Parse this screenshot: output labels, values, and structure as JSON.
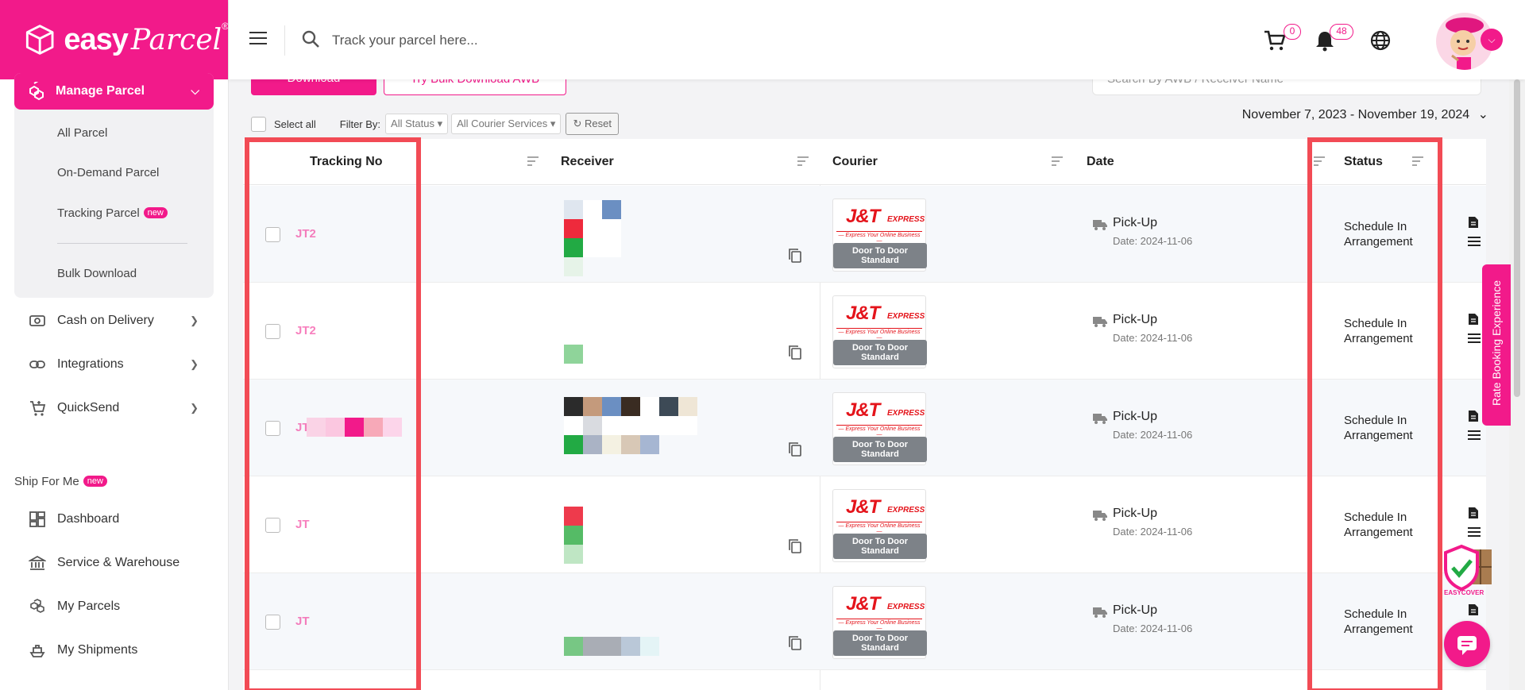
{
  "brand": {
    "name_easy": "easy",
    "name_parcel": "Parcel",
    "reg": "®"
  },
  "header": {
    "search_placeholder": "Track your parcel here...",
    "cart_count": "0",
    "notification_count": "48"
  },
  "sidebar": {
    "active": "Manage Parcel",
    "sub_items": [
      "All Parcel",
      "On-Demand Parcel",
      "Tracking Parcel",
      "Bulk Download"
    ],
    "new_badge": "new",
    "menu": [
      "Cash on Delivery",
      "Integrations",
      "QuickSend"
    ],
    "section": "Ship For Me",
    "ship_items": [
      "Dashboard",
      "Service & Warehouse",
      "My Parcels",
      "My Shipments"
    ]
  },
  "toolbar": {
    "download_label": "Download",
    "bulk_label": "Try Bulk Download AWB",
    "search_placeholder": "Search By AWB / Receiver Name",
    "select_all": "Select all",
    "filter_by": "Filter By:",
    "status_filter": "All Status",
    "courier_filter": "All Courier Services",
    "reset": "Reset",
    "date_range": "November 7, 2023 - November 19, 2024"
  },
  "table": {
    "columns": [
      "Tracking No",
      "Receiver",
      "Courier",
      "Date",
      "Status"
    ],
    "rows": [
      {
        "tracking": "JT2",
        "courier_brand": "J&T",
        "courier_sub": "EXPRESS",
        "tagline": "— Express Your Online Business —",
        "service": "Door To Door Standard",
        "method": "Pick-Up",
        "date": "Date: 2024-11-06",
        "status": "Schedule In Arrangement"
      },
      {
        "tracking": "JT2",
        "courier_brand": "J&T",
        "courier_sub": "EXPRESS",
        "tagline": "— Express Your Online Business —",
        "service": "Door To Door Standard",
        "method": "Pick-Up",
        "date": "Date: 2024-11-06",
        "status": "Schedule In Arrangement"
      },
      {
        "tracking": "JT",
        "courier_brand": "J&T",
        "courier_sub": "EXPRESS",
        "tagline": "— Express Your Online Business —",
        "service": "Door To Door Standard",
        "method": "Pick-Up",
        "date": "Date: 2024-11-06",
        "status": "Schedule In Arrangement"
      },
      {
        "tracking": "JT",
        "courier_brand": "J&T",
        "courier_sub": "EXPRESS",
        "tagline": "— Express Your Online Business —",
        "service": "Door To Door Standard",
        "method": "Pick-Up",
        "date": "Date: 2024-11-06",
        "status": "Schedule In Arrangement"
      },
      {
        "tracking": "JT",
        "courier_brand": "J&T",
        "courier_sub": "EXPRESS",
        "tagline": "— Express Your Online Business —",
        "service": "Door To Door Standard",
        "method": "Pick-Up",
        "date": "Date: 2024-11-06",
        "status": "Schedule In Arrangement"
      }
    ]
  },
  "floating": {
    "rate_booking": "Rate Booking Experience",
    "easycover": "EASYCOVER"
  },
  "colors": {
    "accent": "#f21a8a",
    "highlight": "#f24b55",
    "jt_red": "#e4141b"
  }
}
